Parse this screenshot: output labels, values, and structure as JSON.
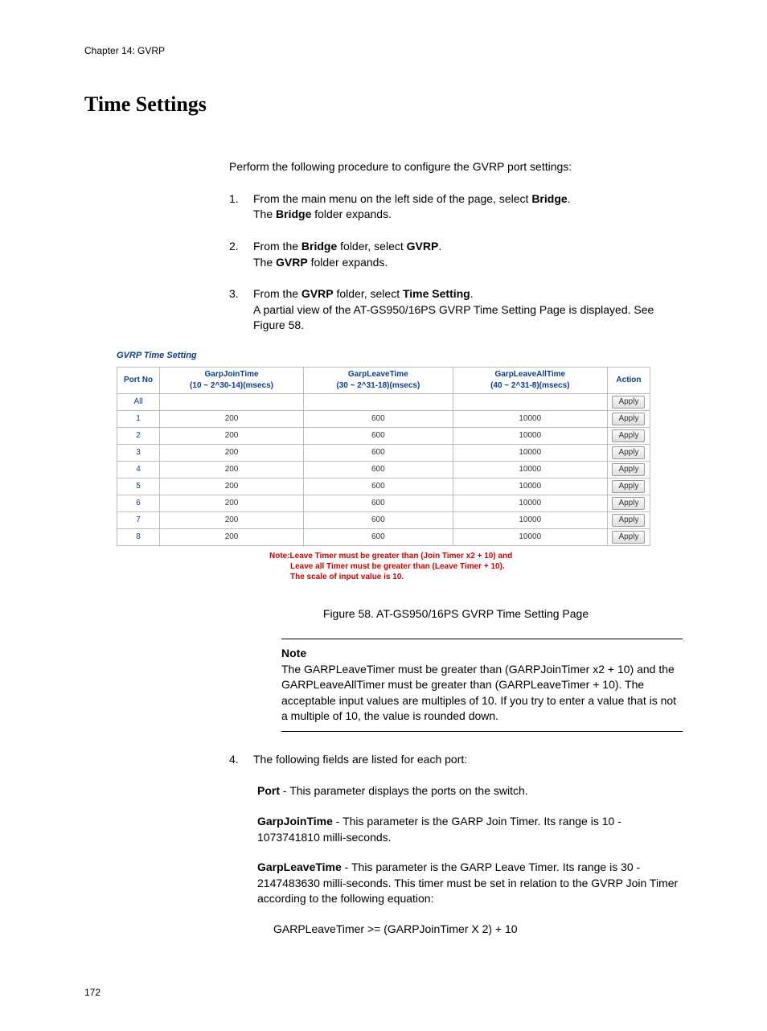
{
  "chapter": "Chapter 14: GVRP",
  "heading": "Time Settings",
  "intro": "Perform the following procedure to configure the GVRP port settings:",
  "steps": {
    "s1a_pre": "From the main menu on the left side of the page, select ",
    "s1a_b": "Bridge",
    "s1a_post": ".",
    "s1b_pre": "The ",
    "s1b_b": "Bridge",
    "s1b_post": " folder expands.",
    "s2a_pre": "From the ",
    "s2a_b1": "Bridge",
    "s2a_mid": " folder, select ",
    "s2a_b2": "GVRP",
    "s2a_post": ".",
    "s2b_pre": "The ",
    "s2b_b": "GVRP",
    "s2b_post": " folder expands.",
    "s3a_pre": "From the ",
    "s3a_b1": "GVRP",
    "s3a_mid": " folder, select ",
    "s3a_b2": "Time Setting",
    "s3a_post": ".",
    "s3b": "A partial view of the AT-GS950/16PS GVRP Time Setting Page is displayed. See Figure 58.",
    "s4": "The following fields are listed for each port:"
  },
  "figure": {
    "panel_title": "GVRP Time Setting",
    "headers": {
      "port": "Port No",
      "join_t": "GarpJoinTime",
      "join_r": "(10 ~ 2^30-14)(msecs)",
      "leave_t": "GarpLeaveTime",
      "leave_r": "(30 ~ 2^31-18)(msecs)",
      "lall_t": "GarpLeaveAllTime",
      "lall_r": "(40 ~ 2^31-8)(msecs)",
      "action": "Action"
    },
    "all_label": "All",
    "apply_label": "Apply",
    "rows": [
      {
        "p": "1",
        "j": "200",
        "l": "600",
        "a": "10000"
      },
      {
        "p": "2",
        "j": "200",
        "l": "600",
        "a": "10000"
      },
      {
        "p": "3",
        "j": "200",
        "l": "600",
        "a": "10000"
      },
      {
        "p": "4",
        "j": "200",
        "l": "600",
        "a": "10000"
      },
      {
        "p": "5",
        "j": "200",
        "l": "600",
        "a": "10000"
      },
      {
        "p": "6",
        "j": "200",
        "l": "600",
        "a": "10000"
      },
      {
        "p": "7",
        "j": "200",
        "l": "600",
        "a": "10000"
      },
      {
        "p": "8",
        "j": "200",
        "l": "600",
        "a": "10000"
      }
    ],
    "red1": "Note:Leave Timer must be greater than (Join Timer x2 + 10) and",
    "red2": "Leave all Timer must be greater than (Leave Timer + 10).",
    "red3": "The scale of input value is 10.",
    "caption": "Figure 58. AT-GS950/16PS GVRP Time Setting Page"
  },
  "note": {
    "title": "Note",
    "body": "The GARPLeaveTimer must be greater than (GARPJoinTimer x2 + 10) and the GARPLeaveAllTimer must be greater than (GARPLeaveTimer + 10). The acceptable input values are multiples of 10. If you try to enter a value that is not a multiple of 10, the value is rounded down."
  },
  "fields": {
    "port_b": "Port",
    "port_t": " - This parameter displays the ports on the switch.",
    "join_b": "GarpJoinTime",
    "join_t": " - This parameter is the GARP Join Timer. Its range is 10 - 1073741810 milli-seconds.",
    "leave_b": "GarpLeaveTime",
    "leave_t": " - This parameter is the GARP Leave Timer. Its range is 30 - 2147483630 milli-seconds. This timer must be set in relation to the GVRP Join Timer according to the following equation:",
    "equation": "GARPLeaveTimer >= (GARPJoinTimer X 2) + 10"
  },
  "page_number": "172"
}
